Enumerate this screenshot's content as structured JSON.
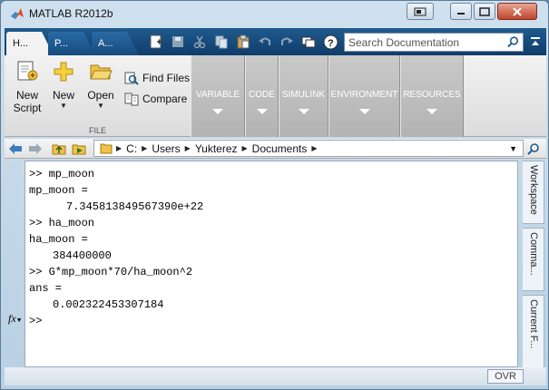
{
  "window": {
    "title": "MATLAB R2012b"
  },
  "tabs": [
    {
      "label": "H..."
    },
    {
      "label": "P..."
    },
    {
      "label": "A..."
    }
  ],
  "search": {
    "placeholder": "Search Documentation"
  },
  "toolstrip": {
    "file": {
      "new_script": "New\nScript",
      "new": "New",
      "open": "Open",
      "find_files": "Find Files",
      "compare": "Compare",
      "section_label": "FILE"
    },
    "collapsed_sections": [
      "VARIABLE",
      "CODE",
      "SIMULINK",
      "ENVIRONMENT",
      "RESOURCES"
    ]
  },
  "address": {
    "path": [
      "C:",
      "Users",
      "Yukterez",
      "Documents"
    ]
  },
  "command_window": {
    "lines": [
      {
        "text": ">> mp_moon",
        "style": ""
      },
      {
        "text": "mp_moon =",
        "style": ""
      },
      {
        "text": "7.345813849567390e+22",
        "style": "indent2"
      },
      {
        "text": ">> ha_moon",
        "style": ""
      },
      {
        "text": "ha_moon =",
        "style": ""
      },
      {
        "text": "384400000",
        "style": "indent"
      },
      {
        "text": ">> G*mp_moon*70/ha_moon^2",
        "style": ""
      },
      {
        "text": "ans =",
        "style": ""
      },
      {
        "text": "0.002322453307184",
        "style": "indent"
      },
      {
        "text": "",
        "style": ""
      },
      {
        "text": ">>",
        "style": ""
      }
    ],
    "fx_label": "fx"
  },
  "side_panels": [
    "Workspace",
    "Comma...",
    "Current F..."
  ],
  "status": {
    "ovr": "OVR"
  },
  "colors": {
    "tabstrip": "#0f3d6b",
    "folder": "#e8b640"
  }
}
